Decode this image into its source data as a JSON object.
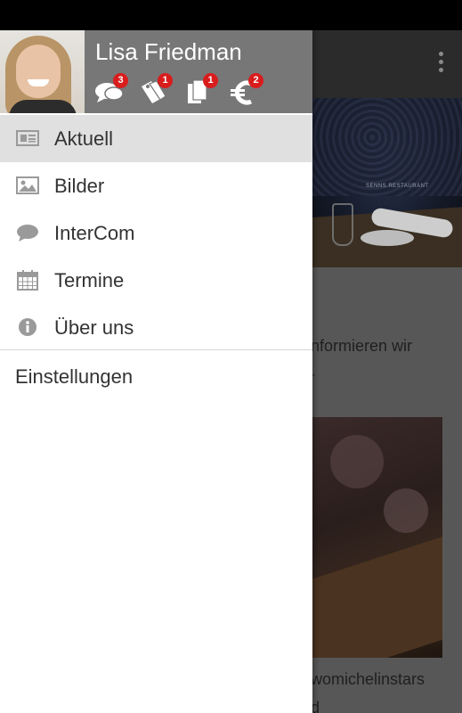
{
  "user": {
    "name": "Lisa Friedman"
  },
  "header_icons": [
    {
      "icon": "chat-icon",
      "badge": "3"
    },
    {
      "icon": "tags-icon",
      "badge": "1"
    },
    {
      "icon": "documents-icon",
      "badge": "1"
    },
    {
      "icon": "euro-icon",
      "badge": "2"
    }
  ],
  "nav": {
    "items": [
      {
        "label": "Aktuell",
        "icon": "newspaper-icon",
        "active": true
      },
      {
        "label": "Bilder",
        "icon": "image-icon",
        "active": false
      },
      {
        "label": "InterCom",
        "icon": "speech-bubble-icon",
        "active": false
      },
      {
        "label": "Termine",
        "icon": "calendar-icon",
        "active": false
      },
      {
        "label": "Über uns",
        "icon": "info-icon",
        "active": false
      }
    ],
    "settings_label": "Einstellungen"
  },
  "background": {
    "line1": "nformieren wir",
    "line2": "-",
    "line3": "womichelinstars",
    "line4": "d"
  },
  "colors": {
    "badge": "#d91c1c",
    "header_bg": "#777777",
    "active_item_bg": "#e0e0e0"
  }
}
